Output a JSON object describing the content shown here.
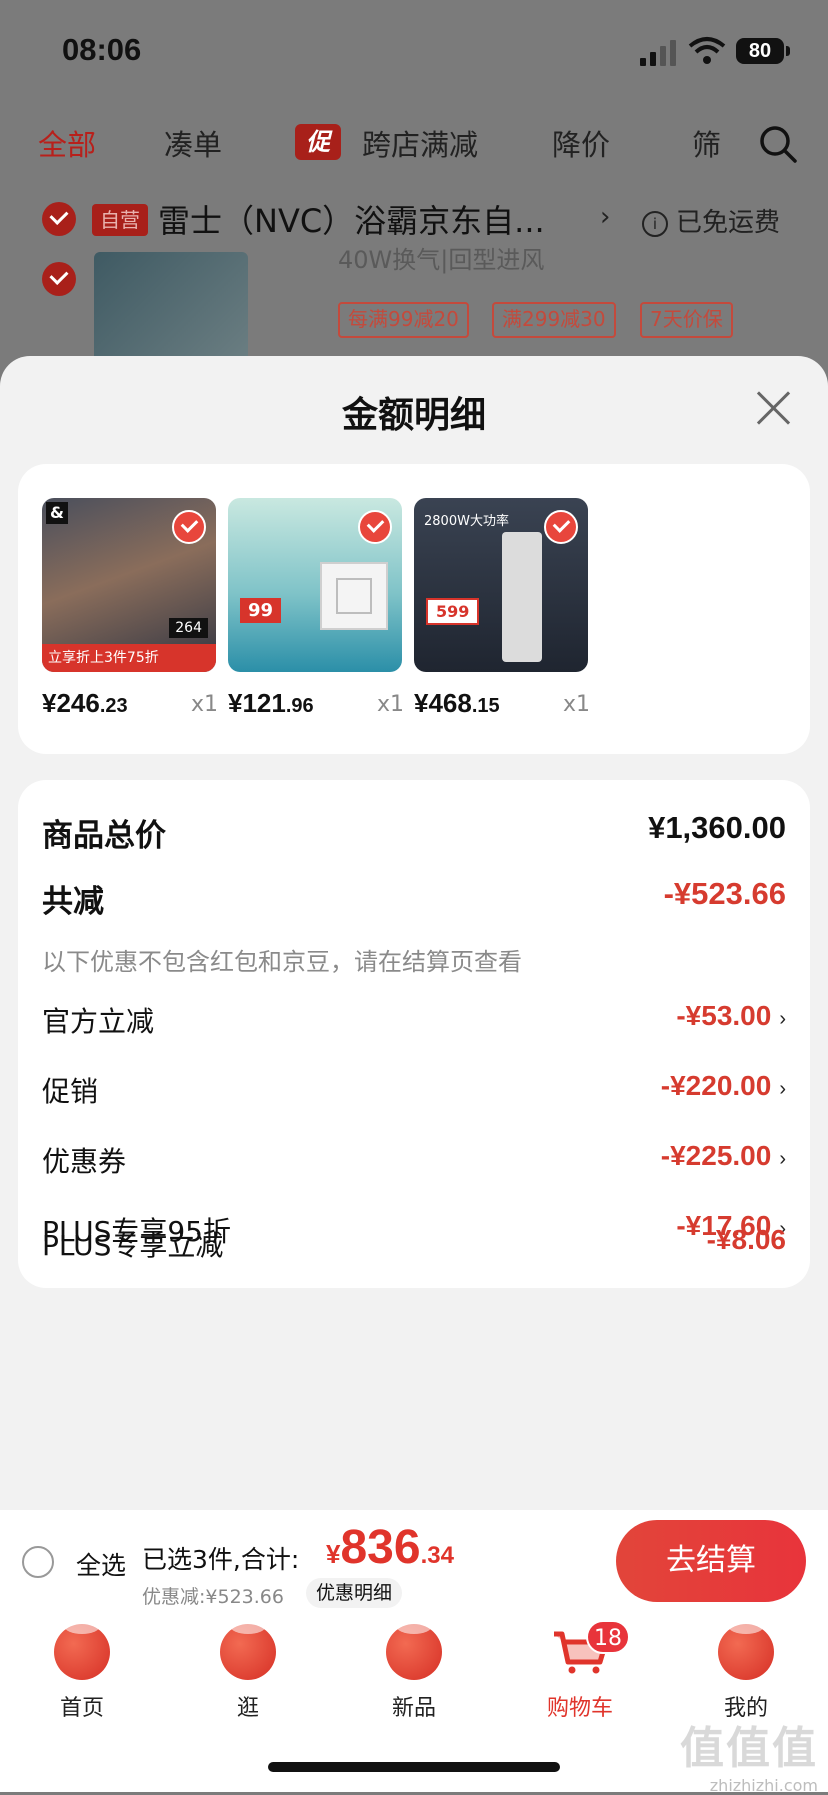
{
  "status": {
    "time": "08:06",
    "battery": "80"
  },
  "filter_tabs": [
    {
      "label": "全部",
      "active": true
    },
    {
      "label": "凑单"
    },
    {
      "badge": "促",
      "label": "跨店满减"
    },
    {
      "label": "降价"
    },
    {
      "label": "筛"
    }
  ],
  "shop": {
    "badge": "自营",
    "name": "雷士（NVC）浴霸京东自...",
    "arrow": "›",
    "free_shipping": "已免运费",
    "info_glyph": "i"
  },
  "background_item": {
    "spec": "40W换气|回型进风",
    "tags": [
      "每满99减20",
      "满299减30",
      "7天价保"
    ]
  },
  "sheet": {
    "title": "金额明细",
    "products": [
      {
        "price_int": "¥246",
        "price_dec": ".23",
        "qty": "x1",
        "strip_text": "立享折上3件75折",
        "count": "264",
        "logo": "&"
      },
      {
        "price_int": "¥121",
        "price_dec": ".96",
        "qty": "x1",
        "promo": "99"
      },
      {
        "price_int": "¥468",
        "price_dec": ".15",
        "qty": "x1",
        "headline": "2800W大功率",
        "promo": "599"
      }
    ],
    "summary": {
      "total_label": "商品总价",
      "total_value": "¥1,360.00",
      "reduce_label": "共减",
      "reduce_value": "-¥523.66",
      "note": "以下优惠不包含红包和京豆，请在结算页查看",
      "items": [
        {
          "label": "官方立减",
          "value": "-¥53.00",
          "chevron": "›"
        },
        {
          "label": "促销",
          "value": "-¥220.00",
          "chevron": "›"
        },
        {
          "label": "优惠券",
          "value": "-¥225.00",
          "chevron": "›"
        },
        {
          "label": "PLUS专享95折",
          "value": "-¥17.60",
          "chevron": "›"
        },
        {
          "label": "PLUS专享立减",
          "value": "-¥8.06"
        }
      ]
    }
  },
  "checkout": {
    "select_all": "全选",
    "selected_text": "已选3件,合计:",
    "currency": "¥",
    "total_int": "836",
    "total_dec": ".34",
    "discount_text": "优惠减:¥523.66",
    "detail_link": "优惠明细",
    "button": "去结算"
  },
  "tabbar": [
    {
      "label": "首页"
    },
    {
      "label": "逛"
    },
    {
      "label": "新品"
    },
    {
      "label": "购物车",
      "active": true,
      "badge": "18"
    },
    {
      "label": "我的"
    }
  ],
  "watermark": {
    "logo": "值值值",
    "site": "zhizhizhi.com"
  },
  "colors": {
    "accent": "#e0342b",
    "sheet_bg": "#f2f2f2",
    "overlay": "#7b7b7b"
  }
}
